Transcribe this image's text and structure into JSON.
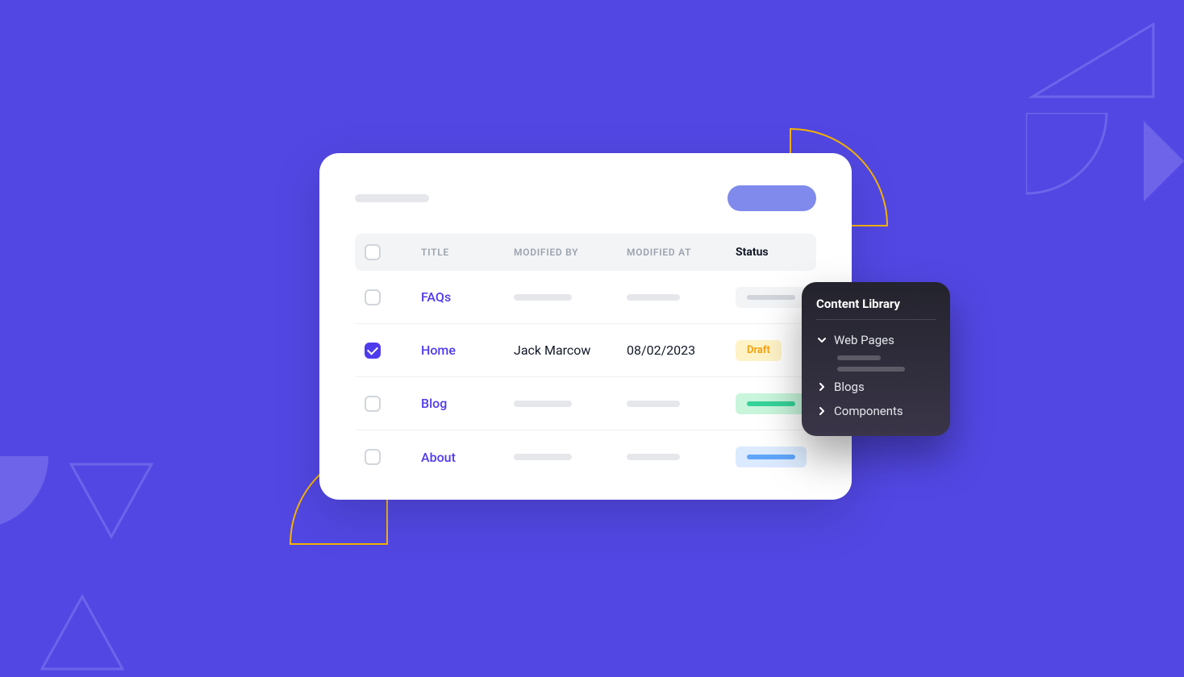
{
  "table": {
    "columns": {
      "title": "TITLE",
      "modified_by": "MODIFIED BY",
      "modified_at": "MODIFIED AT",
      "status": "Status"
    },
    "rows": [
      {
        "checked": false,
        "title": "FAQs",
        "modified_by": null,
        "modified_at": null,
        "status": null,
        "status_kind": "gray"
      },
      {
        "checked": true,
        "title": "Home",
        "modified_by": "Jack Marcow",
        "modified_at": "08/02/2023",
        "status": "Draft",
        "status_kind": "draft"
      },
      {
        "checked": false,
        "title": "Blog",
        "modified_by": null,
        "modified_at": null,
        "status": null,
        "status_kind": "green"
      },
      {
        "checked": false,
        "title": "About",
        "modified_by": null,
        "modified_at": null,
        "status": null,
        "status_kind": "blue"
      }
    ]
  },
  "panel": {
    "title": "Content Library",
    "items": [
      {
        "label": "Web Pages",
        "expanded": true
      },
      {
        "label": "Blogs",
        "expanded": false
      },
      {
        "label": "Components",
        "expanded": false
      }
    ]
  }
}
